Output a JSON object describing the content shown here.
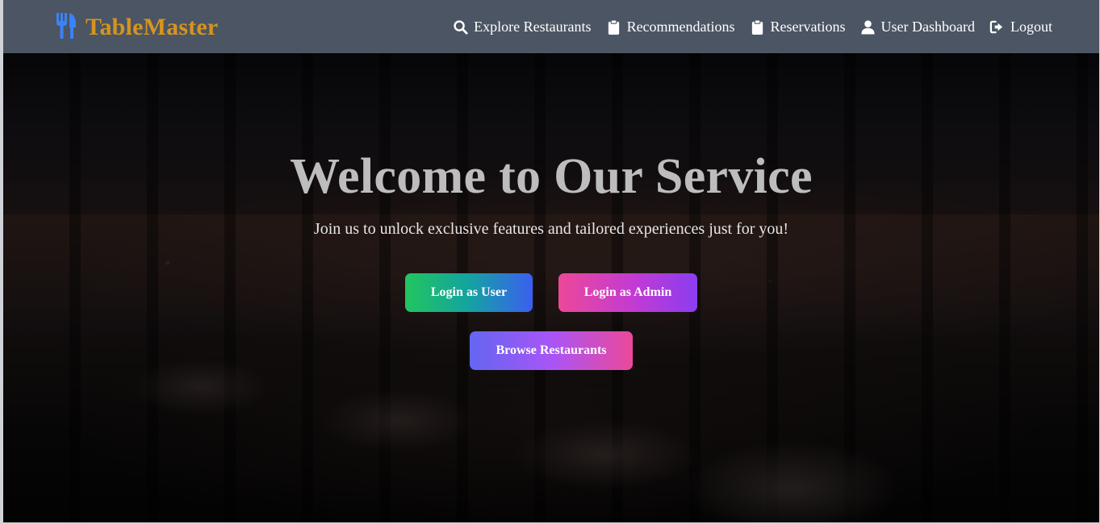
{
  "brand": {
    "name": "TableMaster",
    "icon": "utensils-icon",
    "color": "#d6941f"
  },
  "nav": {
    "items": [
      {
        "label": "Explore Restaurants",
        "icon": "search-icon"
      },
      {
        "label": "Recommendations",
        "icon": "clipboard-icon"
      },
      {
        "label": "Reservations",
        "icon": "clipboard-icon"
      },
      {
        "label": "User Dashboard",
        "icon": "user-icon"
      },
      {
        "label": "Logout",
        "icon": "logout-icon"
      }
    ]
  },
  "hero": {
    "title": "Welcome to Our Service",
    "subtitle": "Join us to unlock exclusive features and tailored experiences just for you!",
    "buttons": {
      "login_user": "Login as User",
      "login_admin": "Login as Admin",
      "browse": "Browse Restaurants"
    }
  },
  "colors": {
    "navbar": "#4b5563",
    "brand": "#d6941f",
    "brand_icon": "#3b82f6"
  }
}
